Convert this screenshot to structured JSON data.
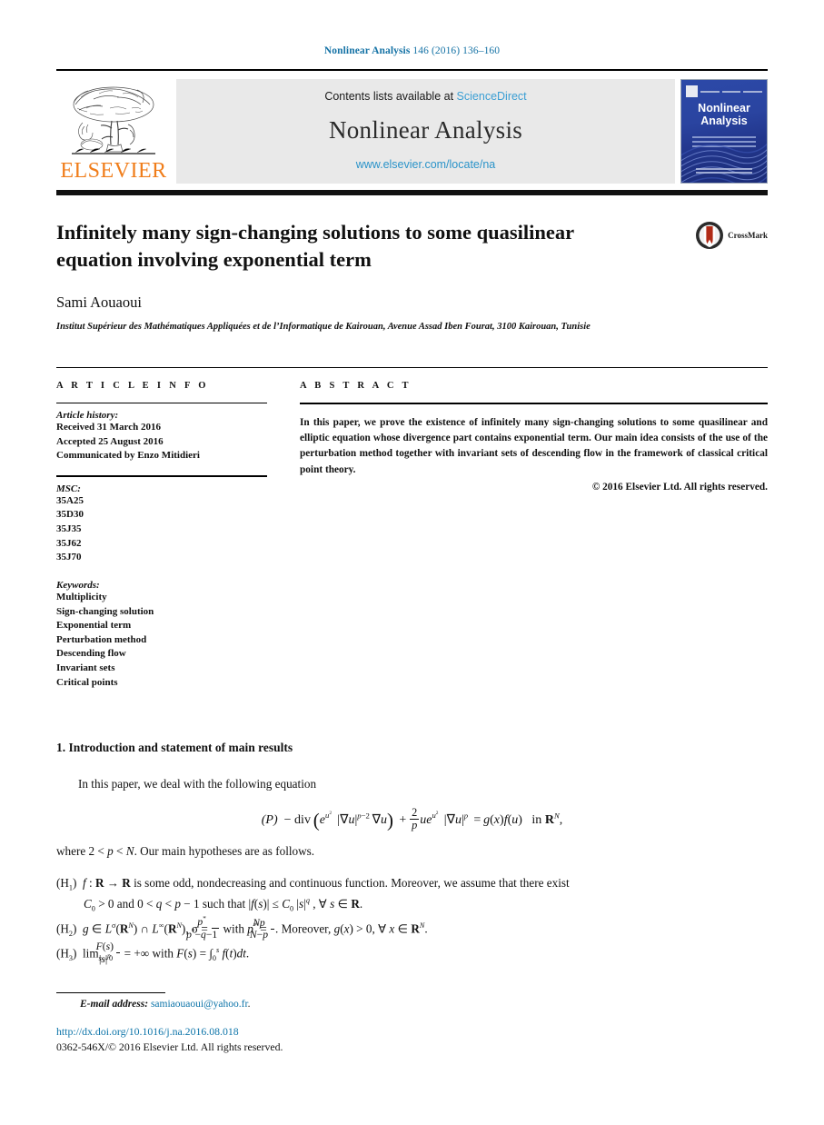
{
  "running_head": {
    "journal_name": "Nonlinear Analysis",
    "citation": "146 (2016) 136–160"
  },
  "masthead": {
    "publisher_name": "ELSEVIER",
    "contents_prefix": "Contents lists available at",
    "sciencedirect": "ScienceDirect",
    "journal_title": "Nonlinear Analysis",
    "journal_url": "www.elsevier.com/locate/na",
    "cover_title_line1": "Nonlinear",
    "cover_title_line2": "Analysis",
    "colors": {
      "link_blue": "#2a93c9",
      "sciencedirect_blue": "#3c9fd4",
      "elsevier_orange": "#f07d1a",
      "running_head_blue": "#1673a6",
      "banner_gray": "#e9e9e9",
      "cover_blue": "#2c49a8"
    }
  },
  "article": {
    "title": "Infinitely many sign-changing solutions to some quasilinear equation involving exponential term",
    "author": "Sami Aouaoui",
    "affiliation": "Institut Supérieur des Mathématiques Appliquées et de l’Informatique de Kairouan, Avenue Assad Iben Fourat, 3100 Kairouan, Tunisie",
    "crossmark_label": "CrossMark"
  },
  "article_info": {
    "kicker": "A R T I C L E   I N F O",
    "history_label": "Article history:",
    "history": [
      "Received 31 March 2016",
      "Accepted 25 August 2016",
      "Communicated by Enzo Mitidieri"
    ],
    "msc_label": "MSC:",
    "msc": [
      "35A25",
      "35D30",
      "35J35",
      "35J62",
      "35J70"
    ],
    "keywords_label": "Keywords:",
    "keywords": [
      "Multiplicity",
      "Sign-changing solution",
      "Exponential term",
      "Perturbation method",
      "Descending flow",
      "Invariant sets",
      "Critical points"
    ]
  },
  "abstract": {
    "kicker": "A B S T R A C T",
    "text": "In this paper, we prove the existence of infinitely many sign-changing solutions to some quasilinear and elliptic equation whose divergence part contains exponential term. Our main idea consists of the use of the perturbation method together with invariant sets of descending flow in the framework of classical critical point theory.",
    "copyright": "© 2016 Elsevier Ltd. All rights reserved."
  },
  "body": {
    "section_heading": "1.  Introduction and statement of main results",
    "intro_paragraph": "In this paper, we deal with the following equation",
    "equation_label": "(P)",
    "equation_plain": "− div ( e^{u²} |∇u|^{p−2} ∇u ) + (2/p) u e^{u²} |∇u|^{p} = g(x) f(u)   in R^N,",
    "after_equation": "where 2 < p < N. Our main hypotheses are as follows.",
    "hypotheses": [
      {
        "label": "(H₁)",
        "line1": "f : R → R is some odd, nondecreasing and continuous function. Moreover, we assume that there exist",
        "line2": "C₀ > 0 and 0 < q < p − 1 such that |f(s)| ≤ C₀ |s|^q , ∀ s ∈ R."
      },
      {
        "label": "(H₂)",
        "line1": "g ∈ L^σ(R^N) ∩ L^∞(R^N), σ = p*/(p*−q−1) with p* = Np/(N−p). Moreover, g(x) > 0, ∀ x ∈ R^N."
      },
      {
        "label": "(H₃)",
        "line1": "lim_{s→0} F(s)/|s|^p = +∞ with F(s) = ∫₀ˢ f(t)dt."
      }
    ]
  },
  "footnote": {
    "label": "E-mail address:",
    "email": "samiaouaoui@yahoo.fr",
    "trailing": "."
  },
  "footer": {
    "doi": "http://dx.doi.org/10.1016/j.na.2016.08.018",
    "issn_line": "0362-546X/© 2016 Elsevier Ltd. All rights reserved."
  }
}
